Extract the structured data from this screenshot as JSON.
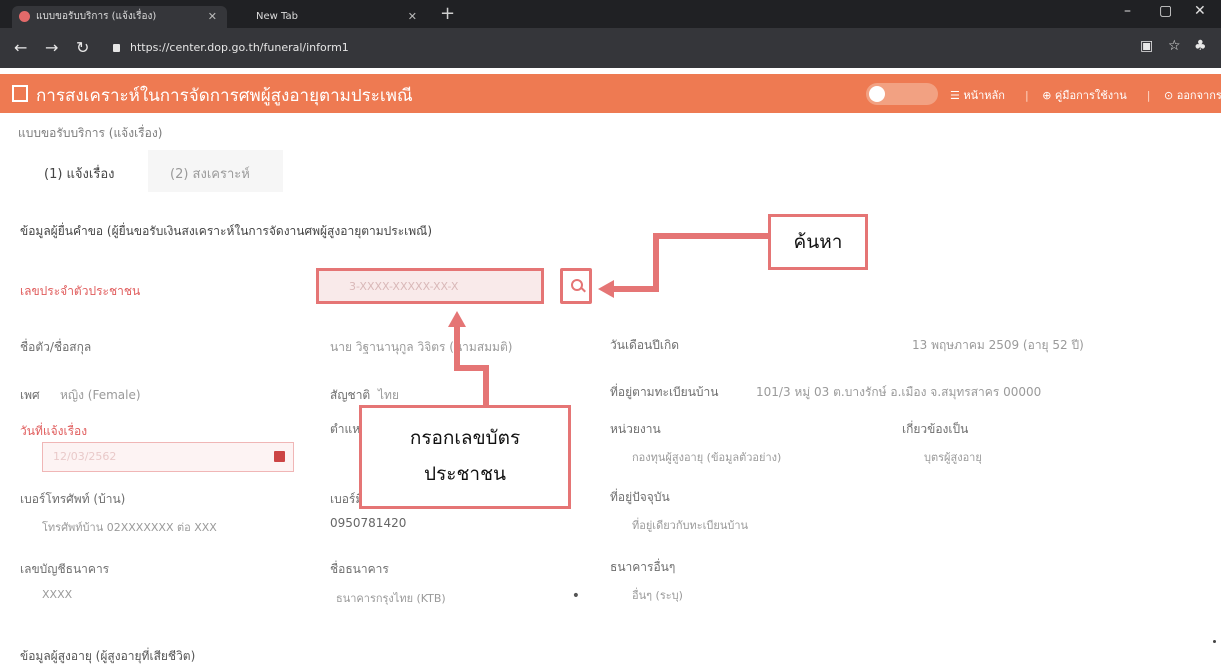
{
  "browser": {
    "tabs": [
      {
        "label": "แบบขอรับบริการ (แจ้งเรื่อง)",
        "active": true
      },
      {
        "label": "New Tab",
        "active": false
      }
    ],
    "url": "https://center.dop.go.th/funeral/inform1",
    "new_tab_symbol": "+",
    "window_controls": [
      "–",
      "▢",
      "✕"
    ]
  },
  "app": {
    "title": "การสงเคราะห์ในการจัดการศพผู้สูงอายุตามประเพณี",
    "nav_links": [
      "หน้าหลัก",
      "คู่มือการใช้งาน",
      "ออกจากระบบ"
    ],
    "accent_color": "#ee7a52"
  },
  "page": {
    "breadcrumb": "แบบขอรับบริการ (แจ้งเรื่อง)",
    "tabs": [
      "(1) แจ้งเรื่อง",
      "(2) สงเคราะห์"
    ],
    "section_title": "ข้อมูลผู้ยื่นคำขอ (ผู้ยื่นขอรับเงินสงเคราะห์ในการจัดงานศพผู้สูงอายุตามประเพณี)",
    "next_section_title": "ข้อมูลผู้สูงอายุ (ผู้สูงอายุที่เสียชีวิต)"
  },
  "form": {
    "citizen_id": {
      "label": "เลขประจำตัวประชาชน",
      "value": "3-XXXX-XXXXX-XX-X"
    },
    "fullname": {
      "label": "ชื่อตัว/ชื่อสกุล",
      "value": "นาย วิฐานานุกูล วิจิตร (นามสมมติ)"
    },
    "birthdate": {
      "label": "วันเดือนปีเกิด",
      "value": "13 พฤษภาคม 2509 (อายุ 52 ปี)"
    },
    "gender": {
      "label": "เพศ",
      "value": "หญิง (Female)"
    },
    "nationality": {
      "label": "สัญชาติ",
      "value": "ไทย"
    },
    "address": {
      "label": "ที่อยู่ตามทะเบียนบ้าน",
      "value": "101/3 หมู่ 03 ต.บางรักษ์ อ.เมือง จ.สมุทรสาคร 00000"
    },
    "report_date": {
      "label": "วันที่แจ้งเรื่อง",
      "value": "12/03/2562"
    },
    "position": {
      "label": "ตำแหน่ง",
      "value": ""
    },
    "agency": {
      "label": "หน่วยงาน",
      "value": "กองทุนผู้สูงอายุ (ข้อมูลตัวอย่าง)"
    },
    "relationship": {
      "label": "เกี่ยวข้องเป็น",
      "value": "บุตรผู้สูงอายุ"
    },
    "home_phone": {
      "label": "เบอร์โทรศัพท์ (บ้าน)",
      "value": "โทรศัพท์บ้าน 02XXXXXXX ต่อ XXX"
    },
    "mobile_phone": {
      "label": "เบอร์มือถือ",
      "value": "0950781420"
    },
    "current_address": {
      "label": "ที่อยู่ปัจจุบัน",
      "value": "ที่อยู่เดียวกับทะเบียนบ้าน"
    },
    "account_no": {
      "label": "เลขบัญชีธนาคาร",
      "value": "XXXX"
    },
    "bank_name": {
      "label": "ชื่อธนาคาร",
      "value": "ธนาคารกรุงไทย (KTB)"
    },
    "branch": {
      "label": "ธนาคารอื่นๆ",
      "value": "อื่นๆ (ระบุ)"
    }
  },
  "annotations": {
    "search_callout": "ค้นหา",
    "input_callout_line1": "กรอกเลขบัตร",
    "input_callout_line2": "ประชาชน",
    "arrow_color": "#e57575"
  }
}
